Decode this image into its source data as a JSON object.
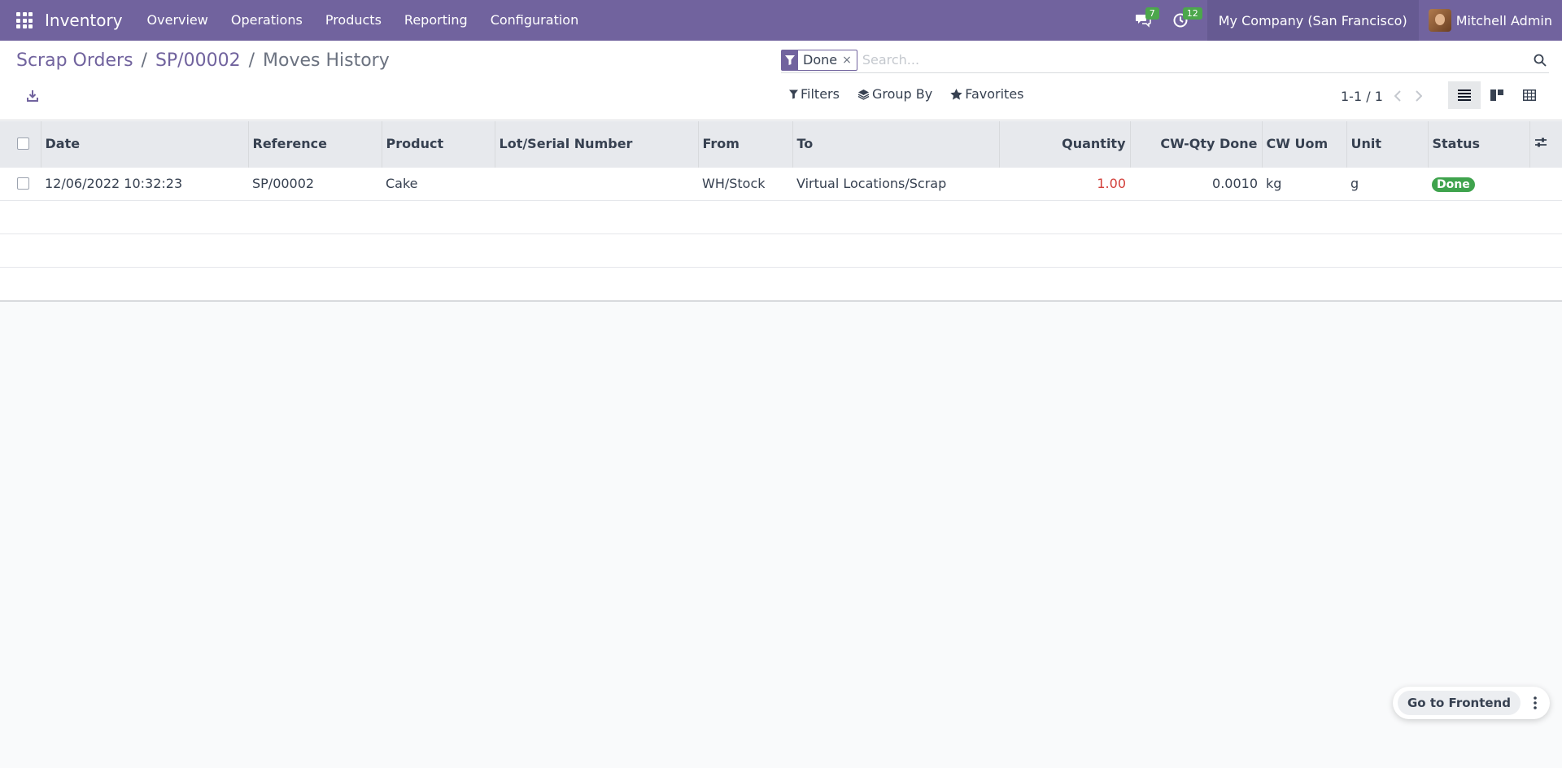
{
  "navbar": {
    "app_name": "Inventory",
    "menu": [
      "Overview",
      "Operations",
      "Products",
      "Reporting",
      "Configuration"
    ],
    "messages_count": "7",
    "activities_count": "12",
    "company": "My Company (San Francisco)",
    "user": "Mitchell Admin"
  },
  "breadcrumb": {
    "items": [
      "Scrap Orders",
      "SP/00002"
    ],
    "separator": "/",
    "current": "Moves History"
  },
  "search": {
    "facet_value": "Done",
    "facet_remove": "×",
    "placeholder": "Search..."
  },
  "filters": {
    "filters_label": "Filters",
    "group_by_label": "Group By",
    "favorites_label": "Favorites"
  },
  "pager": {
    "text": "1-1 / 1"
  },
  "table": {
    "columns": [
      "Date",
      "Reference",
      "Product",
      "Lot/Serial Number",
      "From",
      "To",
      "Quantity",
      "CW-Qty Done",
      "CW Uom",
      "Unit",
      "Status"
    ],
    "rows": [
      {
        "date": "12/06/2022 10:32:23",
        "reference": "SP/00002",
        "product": "Cake",
        "lot": "",
        "from": "WH/Stock",
        "to": "Virtual Locations/Scrap",
        "quantity": "1.00",
        "cw_qty_done": "0.0010",
        "cw_uom": "kg",
        "unit": "g",
        "status": "Done"
      }
    ]
  },
  "frontend": {
    "label": "Go to Frontend"
  },
  "colors": {
    "brand": "#71639e",
    "status_done": "#3fa34d",
    "quantity_red": "#d23f3a"
  }
}
